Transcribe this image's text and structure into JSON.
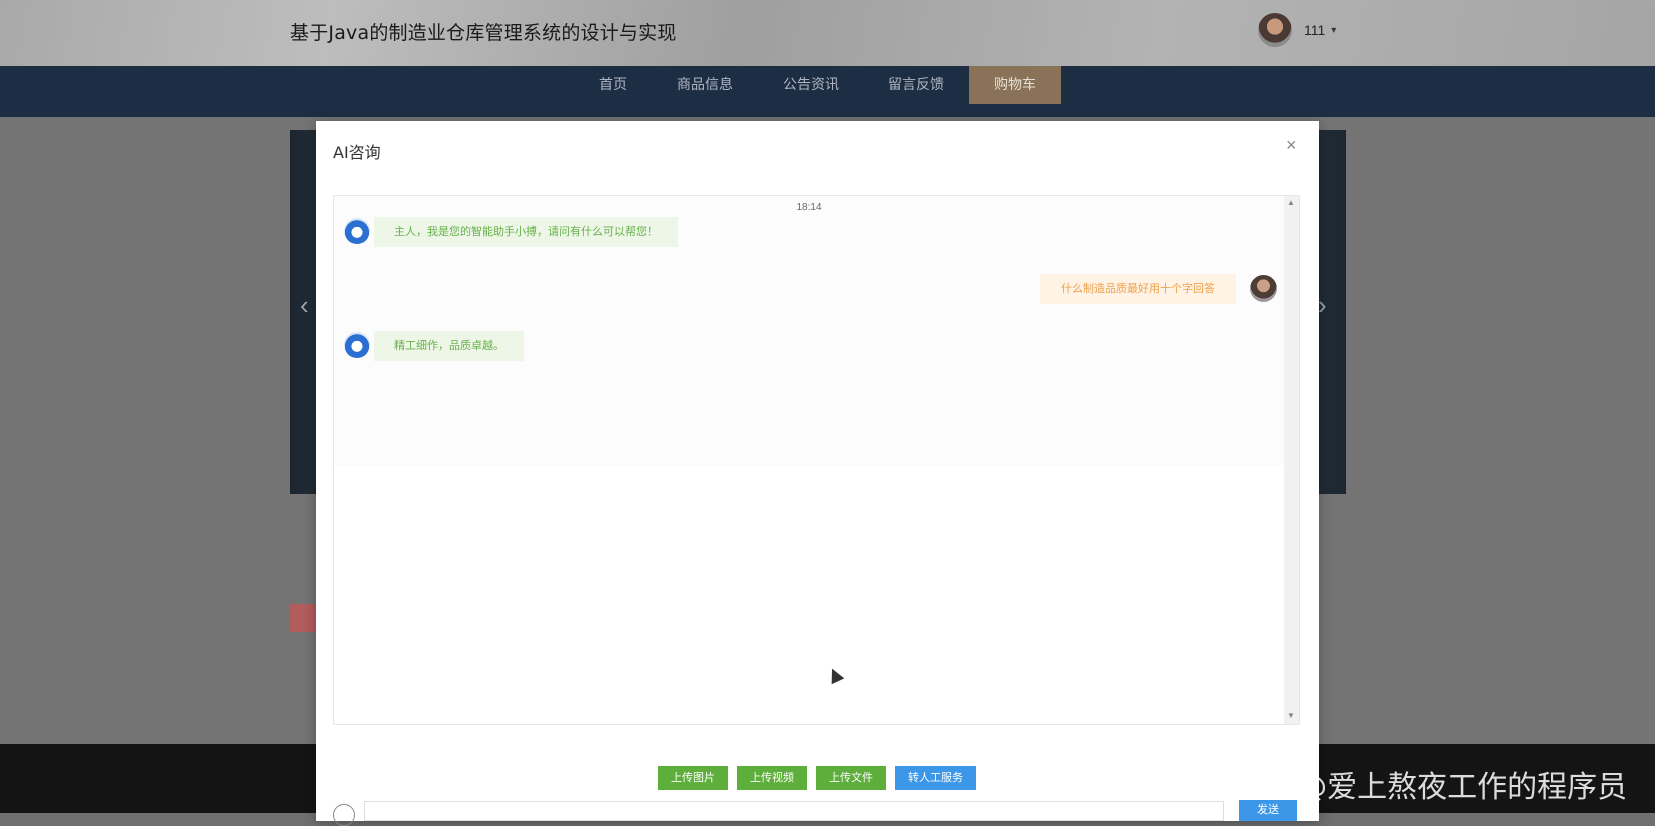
{
  "site": {
    "title": "基于Java的制造业仓库管理系统的设计与实现",
    "user_name": "111",
    "caret": "▾"
  },
  "nav": {
    "items": [
      {
        "label": "首页"
      },
      {
        "label": "商品信息"
      },
      {
        "label": "公告资讯"
      },
      {
        "label": "留言反馈"
      },
      {
        "label": "购物车"
      }
    ]
  },
  "banner": {
    "prev_arrow": "‹",
    "next_arrow": "›"
  },
  "modal": {
    "title": "AI咨询",
    "close": "×"
  },
  "chat": {
    "timestamp": "18:14",
    "messages": [
      {
        "role": "bot",
        "text": "主人，我是您的智能助手小搏，请问有什么可以帮您！"
      },
      {
        "role": "user",
        "text": "什么制造品质最好用十个字回答"
      },
      {
        "role": "bot",
        "text": "精工细作，品质卓越。"
      }
    ]
  },
  "actions": {
    "upload_image": "上传图片",
    "upload_video": "上传视频",
    "upload_file": "上传文件",
    "transfer_human": "转人工服务"
  },
  "input": {
    "placeholder": ""
  },
  "send": {
    "label": "发送"
  },
  "watermark": "CSDN @爱上熬夜工作的程序员",
  "colors": {
    "nav_bg": "#1d2d44",
    "nav_active": "#8a7258",
    "bot_bubble": "#edf6e7",
    "bot_text": "#67b14a",
    "user_bubble": "#fff3e6",
    "user_text": "#f0a04b",
    "green_button": "#5eae3c",
    "blue_button": "#3d97e8"
  }
}
